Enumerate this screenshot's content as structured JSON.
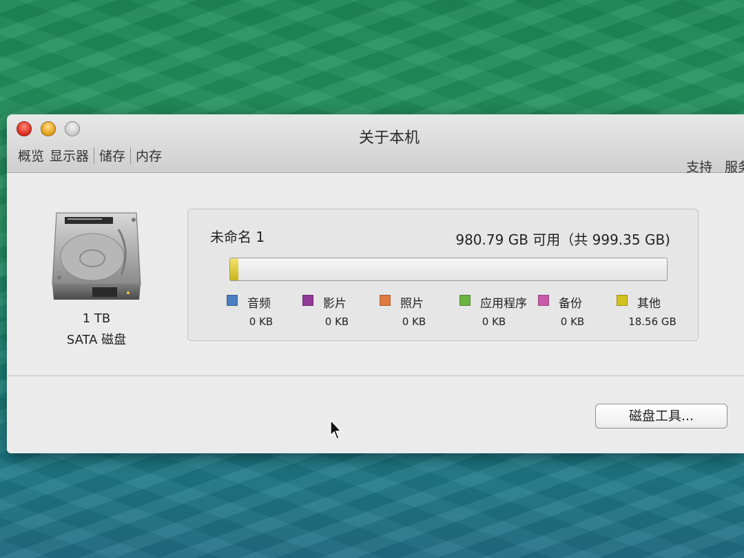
{
  "window": {
    "title": "关于本机",
    "tabs": [
      "概览",
      "显示器",
      "储存",
      "内存"
    ],
    "right_links": [
      "支持",
      "服务"
    ]
  },
  "disk": {
    "icon": "hard-drive-icon",
    "size": "1 TB",
    "type": "SATA 磁盘"
  },
  "volume": {
    "name": "未命名 1",
    "available": "980.79 GB 可用（共 999.35 GB)",
    "used_fraction": 0.0186
  },
  "legend": [
    {
      "label": "音频",
      "value": "0 KB",
      "color": "#4a7fc1"
    },
    {
      "label": "影片",
      "value": "0 KB",
      "color": "#8e3a96"
    },
    {
      "label": "照片",
      "value": "0 KB",
      "color": "#e07a3e"
    },
    {
      "label": "应用程序",
      "value": "0 KB",
      "color": "#6cb342"
    },
    {
      "label": "备份",
      "value": "0 KB",
      "color": "#c95aa8"
    },
    {
      "label": "其他",
      "value": "18.56 GB",
      "color": "#d2c11f"
    }
  ],
  "buttons": {
    "disk_utility": "磁盘工具..."
  }
}
